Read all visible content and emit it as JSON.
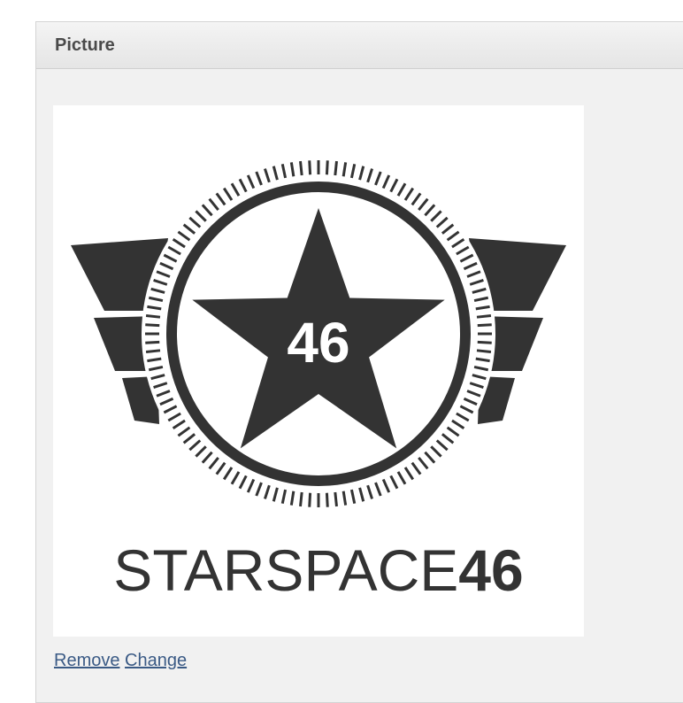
{
  "panel": {
    "title": "Picture"
  },
  "picture": {
    "logo_badge_number": "46",
    "logo_wordmark_light": "STARSPACE",
    "logo_wordmark_bold": "46",
    "logo_color": "#333333"
  },
  "actions": {
    "remove_label": "Remove",
    "change_label": "Change"
  }
}
